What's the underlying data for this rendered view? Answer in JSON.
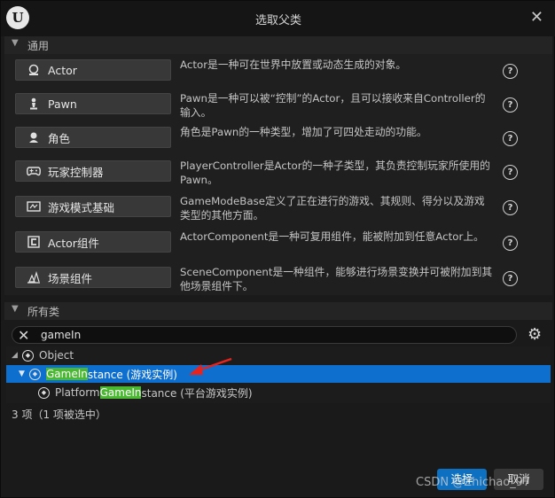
{
  "window": {
    "title": "选取父类"
  },
  "common": {
    "header": "通用",
    "items": [
      {
        "label": "Actor",
        "icon": "actor-icon",
        "desc": "Actor是一种可在世界中放置或动态生成的对象。"
      },
      {
        "label": "Pawn",
        "icon": "pawn-icon",
        "desc": "Pawn是一种可以被“控制”的Actor，且可以接收来自Controller的输入。"
      },
      {
        "label": "角色",
        "icon": "character-icon",
        "desc": "角色是Pawn的一种类型，增加了可四处走动的功能。"
      },
      {
        "label": "玩家控制器",
        "icon": "gamepad-icon",
        "desc": "PlayerController是Actor的一种子类型，其负责控制玩家所使用的Pawn。"
      },
      {
        "label": "游戏模式基础",
        "icon": "game-mode-icon",
        "desc": "GameModeBase定义了正在进行的游戏、其规则、得分以及游戏类型的其他方面。"
      },
      {
        "label": "Actor组件",
        "icon": "component-icon",
        "desc": "ActorComponent是一种可复用组件，能被附加到任意Actor上。"
      },
      {
        "label": "场景组件",
        "icon": "scene-component-icon",
        "desc": "SceneComponent是一种组件，能够进行场景变换并可被附加到其他场景组件下。"
      }
    ]
  },
  "all_classes": {
    "header": "所有类",
    "search_value": "gameIn",
    "tree": {
      "root": "Object",
      "selected": {
        "match": "GameIn",
        "rest": "stance (游戏实例)"
      },
      "child": {
        "prefix": "Platform",
        "match": "GameIn",
        "rest": "stance (平台游戏实例)"
      }
    },
    "status": "3 项（1 项被选中）"
  },
  "buttons": {
    "select": "选择",
    "cancel": "取消"
  },
  "watermark": "CSDN @Zhichao_97",
  "colors": {
    "selection": "#0e6fcf",
    "highlight": "#4bb832",
    "primary_button": "#0e70c0",
    "annotation_arrow": "#e8231e"
  }
}
